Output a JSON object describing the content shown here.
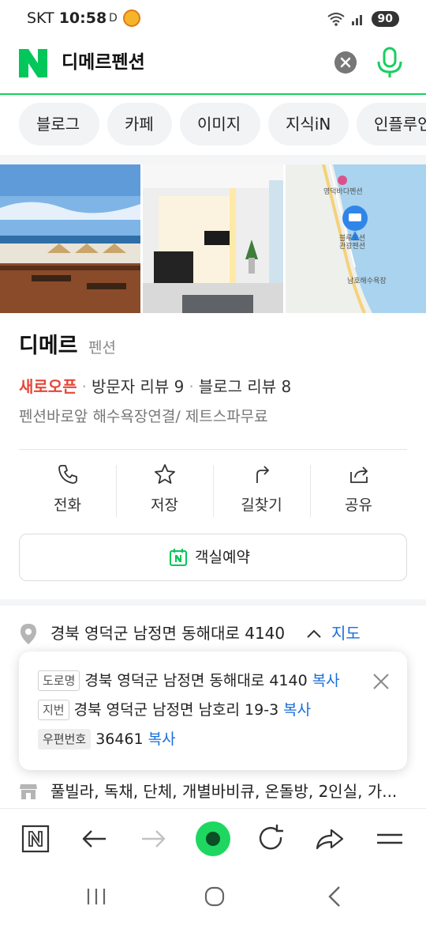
{
  "status_bar": {
    "carrier": "SKT",
    "time": "10:58",
    "indicator": "D",
    "battery": "90"
  },
  "search": {
    "logo_letter": "N",
    "query": "디메르펜션"
  },
  "tabs": [
    "블로그",
    "카페",
    "이미지",
    "지식iN",
    "인플루언"
  ],
  "place": {
    "name": "디메르",
    "category": "펜션",
    "new_open": "새로오픈",
    "visitor_reviews": "방문자 리뷰 9",
    "blog_reviews": "블로그 리뷰 8",
    "description": "펜션바로앞 해수욕장연결/ 제트스파무료"
  },
  "map_labels": {
    "label1": "영덕바다펜션",
    "label2": "블루오션",
    "label3": "관광펜션",
    "label4": "남호해수욕장"
  },
  "actions": {
    "call": "전화",
    "save": "저장",
    "directions": "길찾기",
    "share": "공유"
  },
  "booking": {
    "label": "객실예약"
  },
  "address": {
    "main": "경북 영덕군 남정면 동해대로 4140",
    "map_link": "지도",
    "road_tag": "도로명",
    "road": "경북 영덕군 남정면 동해대로 4140",
    "lot_tag": "지번",
    "lot": "경북 영덕군 남정면 남호리 19-3",
    "zip_tag": "우편번호",
    "zip": "36461",
    "copy": "복사"
  },
  "amenities": "풀빌라, 독채, 단체, 개별바비큐, 온돌방, 2인실, 가...",
  "colors": {
    "brand_green": "#19ce60",
    "new_red": "#e5473a",
    "link_blue": "#1a6ed8"
  },
  "icons": {
    "clear": "close-circle-icon",
    "mic": "microphone-icon",
    "call": "phone-icon",
    "save": "star-icon",
    "directions": "turn-arrow-icon",
    "share": "share-icon",
    "booking": "naver-calendar-icon",
    "pin": "location-pin-icon",
    "amenity": "store-icon"
  }
}
